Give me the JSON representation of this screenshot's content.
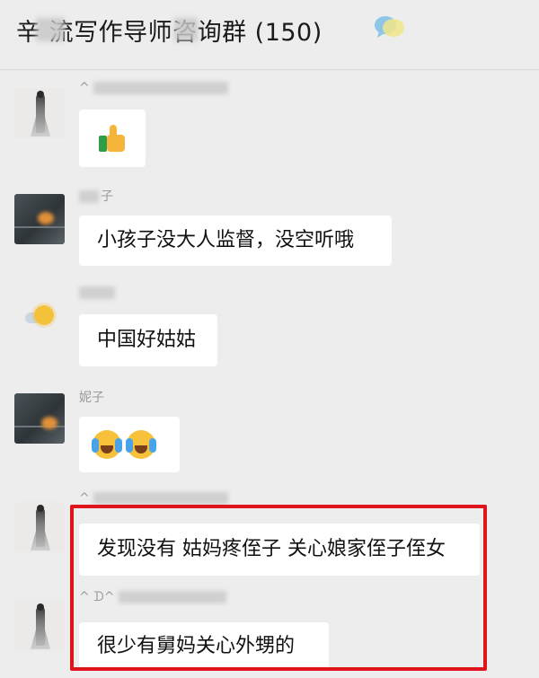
{
  "header": {
    "title": "辛 流写作导师咨询群 (150)",
    "chat_icon": "chat-bubbles-icon"
  },
  "messages": [
    {
      "sender": "^",
      "avatar": "dress-figure",
      "type": "emoji",
      "content_icon": "thumbs-up-emoji"
    },
    {
      "sender": "子",
      "avatar": "dark-landscape",
      "type": "text",
      "text": "小孩子没大人监督，没空听哦"
    },
    {
      "sender": "",
      "avatar": "sun-cloud",
      "type": "text",
      "text": "中国好姑姑"
    },
    {
      "sender": "妮子",
      "avatar": "dark-landscape",
      "type": "emoji",
      "content_icon": "crying-laughing-emoji"
    },
    {
      "sender": "^",
      "avatar": "dress-figure",
      "type": "text",
      "text": "发现没有 姑妈疼侄子 关心娘家侄子侄女"
    },
    {
      "sender": "^ ᗪ^",
      "avatar": "dress-figure",
      "type": "text",
      "text": "很少有舅妈关心外甥的"
    }
  ],
  "colors": {
    "background": "#ededed",
    "bubble": "#ffffff",
    "highlight": "#e0141b"
  }
}
